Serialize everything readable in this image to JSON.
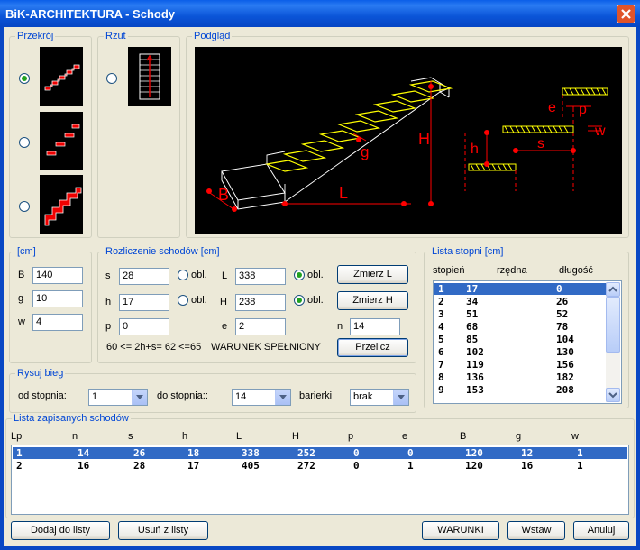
{
  "window": {
    "title": "BiK-ARCHITEKTURA - Schody"
  },
  "groups": {
    "przekroj": "Przekrój",
    "rzut": "Rzut",
    "podglad": "Podgląd",
    "units": "[cm]",
    "rozliczenie": "Rozliczenie schodów [cm]",
    "lista_stopni": "Lista stopni [cm]",
    "rysuj_bieg": "Rysuj bieg",
    "lista_zapisanych": "Lista zapisanych schodów"
  },
  "preview_labels": {
    "B": "B",
    "L": "L",
    "H": "H",
    "g": "g",
    "h": "h",
    "s": "s",
    "e": "e",
    "p": "p",
    "w": "w"
  },
  "units": {
    "B": {
      "label": "B",
      "value": "140"
    },
    "g": {
      "label": "g",
      "value": "10"
    },
    "w": {
      "label": "w",
      "value": "4"
    }
  },
  "rozliczenie": {
    "s": {
      "label": "s",
      "value": "28"
    },
    "h": {
      "label": "h",
      "value": "17"
    },
    "p": {
      "label": "p",
      "value": "0"
    },
    "L": {
      "label": "L",
      "value": "338"
    },
    "H": {
      "label": "H",
      "value": "238"
    },
    "e": {
      "label": "e",
      "value": "2"
    },
    "n": {
      "label": "n",
      "value": "14"
    },
    "obl": "obl.",
    "condition": "60 <= 2h+s= 62 <=65",
    "status": "WARUNEK SPEŁNIONY",
    "btn_zmierz_l": "Zmierz L",
    "btn_zmierz_h": "Zmierz H",
    "btn_przelicz": "Przelicz"
  },
  "lista_stopni": {
    "headers": [
      "stopień",
      "rzędna",
      "długość"
    ],
    "rows": [
      [
        "1",
        "17",
        "0"
      ],
      [
        "2",
        "34",
        "26"
      ],
      [
        "3",
        "51",
        "52"
      ],
      [
        "4",
        "68",
        "78"
      ],
      [
        "5",
        "85",
        "104"
      ],
      [
        "6",
        "102",
        "130"
      ],
      [
        "7",
        "119",
        "156"
      ],
      [
        "8",
        "136",
        "182"
      ],
      [
        "9",
        "153",
        "208"
      ]
    ]
  },
  "rysuj_bieg": {
    "od_label": "od stopnia:",
    "od_value": "1",
    "do_label": "do stopnia::",
    "do_value": "14",
    "bariery_label": "barierki",
    "bariery_value": "brak"
  },
  "zapisane": {
    "headers": [
      "Lp",
      "n",
      "s",
      "h",
      "L",
      "H",
      "p",
      "e",
      "B",
      "g",
      "w"
    ],
    "rows": [
      [
        "1",
        "14",
        "26",
        "18",
        "338",
        "252",
        "0",
        "0",
        "120",
        "12",
        "1"
      ],
      [
        "2",
        "16",
        "28",
        "17",
        "405",
        "272",
        "0",
        "1",
        "120",
        "16",
        "1"
      ]
    ]
  },
  "buttons": {
    "dodaj": "Dodaj do listy",
    "usun": "Usuń z listy",
    "warunki": "WARUNKI",
    "wstaw": "Wstaw",
    "anuluj": "Anuluj"
  },
  "colors": {
    "accent": "#0046d5",
    "selection": "#316ac5",
    "preview_bg": "#000000",
    "stair_yellow": "#ffff00",
    "dim_red": "#ff0000"
  }
}
